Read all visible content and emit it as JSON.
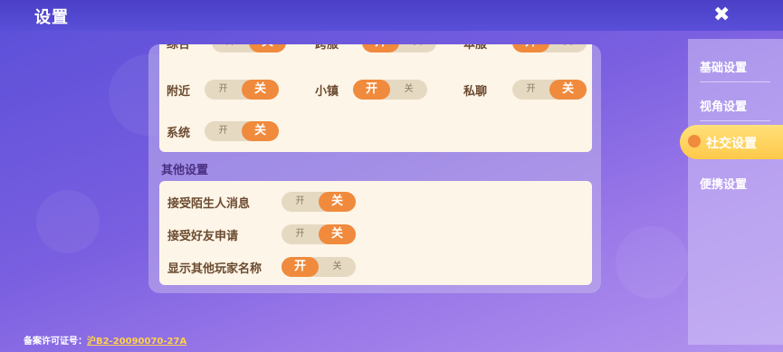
{
  "header": {
    "title": "设置",
    "close_icon": "close-icon"
  },
  "social_toggles_top": [
    {
      "label": "综合",
      "on_label": "开",
      "off_label": "关",
      "value": "off"
    },
    {
      "label": "跨服",
      "on_label": "开",
      "off_label": "关",
      "value": "on"
    },
    {
      "label": "本服",
      "on_label": "开",
      "off_label": "关",
      "value": "on"
    }
  ],
  "social_toggles": [
    {
      "label": "附近",
      "on_label": "开",
      "off_label": "关",
      "value": "off"
    },
    {
      "label": "小镇",
      "on_label": "开",
      "off_label": "关",
      "value": "on"
    },
    {
      "label": "私聊",
      "on_label": "开",
      "off_label": "关",
      "value": "off"
    },
    {
      "label": "系统",
      "on_label": "开",
      "off_label": "关",
      "value": "off"
    }
  ],
  "other_section": {
    "title": "其他设置",
    "items": [
      {
        "label": "接受陌生人消息",
        "on_label": "开",
        "off_label": "关",
        "value": "off"
      },
      {
        "label": "接受好友申请",
        "on_label": "开",
        "off_label": "关",
        "value": "off"
      },
      {
        "label": "显示其他玩家名称",
        "on_label": "开",
        "off_label": "关",
        "value": "on"
      }
    ]
  },
  "sidebar": {
    "items": [
      {
        "label": "基础设置",
        "active": false
      },
      {
        "label": "视角设置",
        "active": false
      },
      {
        "label": "社交设置",
        "active": true
      },
      {
        "label": "便携设置",
        "active": false
      }
    ]
  },
  "footer": {
    "license_label": "备案许可证号：",
    "license_value": "沪B2-20090070-27A"
  },
  "colors": {
    "accent": "#f08a3c",
    "panel_bg": "#fdf5e7",
    "active_tab": "#ffc94a"
  }
}
